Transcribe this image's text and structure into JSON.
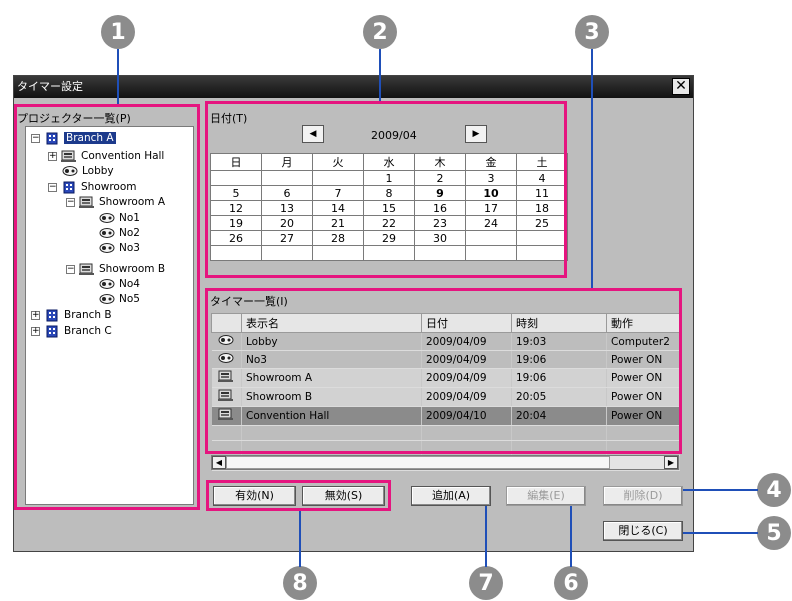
{
  "window": {
    "title": "タイマー設定",
    "close_glyph": "✕"
  },
  "callouts": [
    "1",
    "2",
    "3",
    "4",
    "5",
    "6",
    "7",
    "8"
  ],
  "projector_list": {
    "label": "プロジェクター一覧(P)",
    "tree": [
      {
        "exp": "−",
        "icon": "building-icon",
        "label": "Branch A",
        "selected": true
      },
      {
        "exp": "+",
        "icon": "projector-stack-icon",
        "label": "Convention Hall"
      },
      {
        "exp": "",
        "icon": "projector-icon",
        "label": "Lobby"
      },
      {
        "exp": "−",
        "icon": "building-icon",
        "label": "Showroom"
      },
      {
        "exp": "−",
        "icon": "projector-stack-icon",
        "label": "Showroom A"
      },
      {
        "exp": "",
        "icon": "projector-icon",
        "label": "No1"
      },
      {
        "exp": "",
        "icon": "projector-icon",
        "label": "No2"
      },
      {
        "exp": "",
        "icon": "projector-icon",
        "label": "No3"
      },
      {
        "exp": "−",
        "icon": "projector-stack-icon",
        "label": "Showroom B"
      },
      {
        "exp": "",
        "icon": "projector-icon",
        "label": "No4"
      },
      {
        "exp": "",
        "icon": "projector-icon",
        "label": "No5"
      },
      {
        "exp": "+",
        "icon": "building-icon",
        "label": "Branch B"
      },
      {
        "exp": "+",
        "icon": "building-icon",
        "label": "Branch C"
      }
    ]
  },
  "date": {
    "label": "日付(T)",
    "month": "2009/04",
    "prev_glyph": "◀",
    "next_glyph": "▶",
    "weekdays": [
      "日",
      "月",
      "火",
      "水",
      "木",
      "金",
      "土"
    ],
    "weeks": [
      [
        "",
        "",
        "",
        "1",
        "2",
        "3",
        "4"
      ],
      [
        "5",
        "6",
        "7",
        "8",
        "9",
        "10",
        "11"
      ],
      [
        "12",
        "13",
        "14",
        "15",
        "16",
        "17",
        "18"
      ],
      [
        "19",
        "20",
        "21",
        "22",
        "23",
        "24",
        "25"
      ],
      [
        "26",
        "27",
        "28",
        "29",
        "30",
        "",
        ""
      ],
      [
        "",
        "",
        "",
        "",
        "",
        "",
        ""
      ]
    ],
    "today": "9",
    "bold_days": [
      "9",
      "10"
    ]
  },
  "timer_list": {
    "label": "タイマー一覧(I)",
    "columns": [
      "",
      "表示名",
      "日付",
      "時刻",
      "動作"
    ],
    "rows": [
      {
        "icon": "projector-icon",
        "name": "Lobby",
        "date": "2009/04/09",
        "time": "19:03",
        "action": "Computer2",
        "style": ""
      },
      {
        "icon": "projector-icon",
        "name": "No3",
        "date": "2009/04/09",
        "time": "19:06",
        "action": "Power ON",
        "style": ""
      },
      {
        "icon": "projector-stack-icon",
        "name": "Showroom A",
        "date": "2009/04/09",
        "time": "19:06",
        "action": "Power ON",
        "style": "g"
      },
      {
        "icon": "projector-stack-icon",
        "name": "Showroom B",
        "date": "2009/04/09",
        "time": "20:05",
        "action": "Power ON",
        "style": "g"
      },
      {
        "icon": "projector-stack-icon",
        "name": "Convention Hall",
        "date": "2009/04/10",
        "time": "20:04",
        "action": "Power ON",
        "style": "dk"
      }
    ],
    "scroll_left": "◀",
    "scroll_right": "▶"
  },
  "buttons": {
    "enable": "有効(N)",
    "disable": "無効(S)",
    "add": "追加(A)",
    "edit": "編集(E)",
    "delete": "削除(D)",
    "close": "閉じる(C)"
  },
  "colors": {
    "highlight": "#e5157f",
    "callout": "#8c8c8c",
    "leader": "#1f4fb8",
    "selection": "#1c3a8c"
  }
}
